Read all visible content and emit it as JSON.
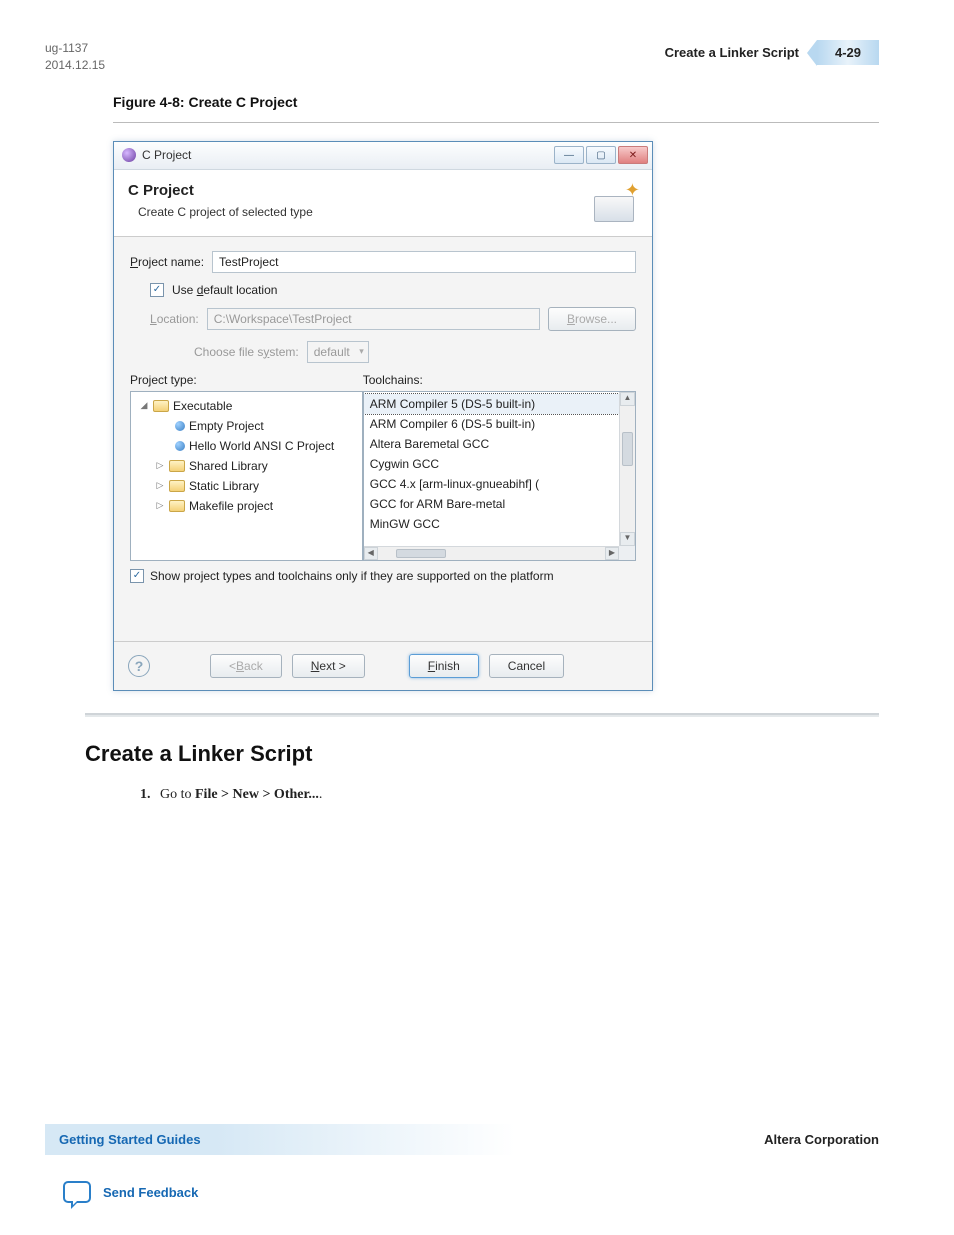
{
  "doc": {
    "id": "ug-1137",
    "date": "2014.12.15"
  },
  "header": {
    "title": "Create a Linker Script",
    "page": "4-29"
  },
  "figure_caption": "Figure 4-8: Create C Project",
  "dialog": {
    "title": "C Project",
    "head_title": "C Project",
    "head_sub": "Create C project of selected type",
    "project_name_label": "Project name:",
    "project_name": "TestProject",
    "use_default": "Use default location",
    "location_label": "Location:",
    "location": "C:\\Workspace\\TestProject",
    "browse": "Browse...",
    "choose_fs": "Choose file system:",
    "fs_value": "default",
    "project_type_label": "Project type:",
    "toolchains_label": "Toolchains:",
    "tree": {
      "exec": "Executable",
      "empty": "Empty Project",
      "hello": "Hello World ANSI C Project",
      "shared": "Shared Library",
      "static": "Static Library",
      "make": "Makefile project"
    },
    "toolchains": [
      "ARM Compiler 5 (DS-5 built-in)",
      "ARM Compiler 6 (DS-5 built-in)",
      "Altera Baremetal GCC",
      "Cygwin GCC",
      "GCC 4.x [arm-linux-gnueabihf] (",
      "GCC for ARM Bare-metal",
      "MinGW GCC"
    ],
    "show_supported": "Show project types and toolchains only if they are supported on the platform",
    "back": "< Back",
    "next": "Next >",
    "finish": "Finish",
    "cancel": "Cancel"
  },
  "section": {
    "heading": "Create a Linker Script",
    "step_num": "1.",
    "step_prefix": "Go to ",
    "step_path": "File > New > Other...",
    "step_suffix": "."
  },
  "footer": {
    "guides": "Getting Started Guides",
    "corp": "Altera Corporation",
    "feedback": "Send Feedback"
  }
}
